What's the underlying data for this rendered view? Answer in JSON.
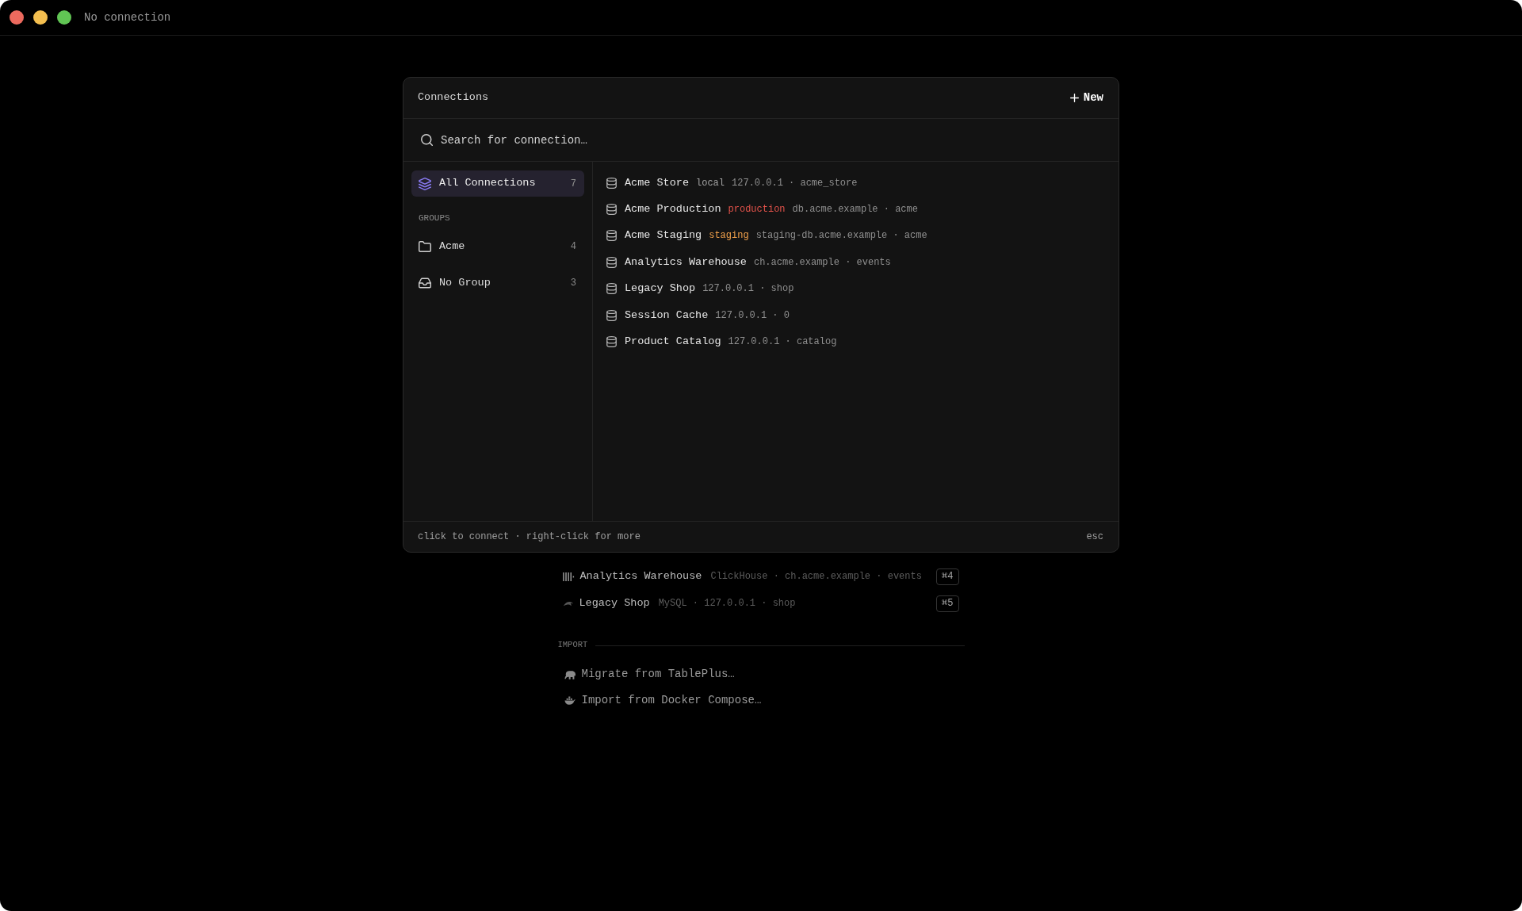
{
  "window": {
    "title": "No connection"
  },
  "dialog": {
    "title": "Connections",
    "new_button": "New",
    "search": {
      "placeholder": "Search for connection…"
    },
    "sidebar": {
      "items": [
        {
          "kind": "layers",
          "label": "All Connections",
          "count": "7",
          "selected": true
        }
      ],
      "groups_heading": "GROUPS",
      "groups": [
        {
          "kind": "folder",
          "label": "Acme",
          "count": "4",
          "selected": false
        },
        {
          "kind": "inbox",
          "label": "No Group",
          "count": "3",
          "selected": false
        }
      ]
    },
    "connections": [
      {
        "name": "Acme Store",
        "tag": {
          "text": "local",
          "color": "#a3a3a3"
        },
        "details": "127.0.0.1 · acme_store"
      },
      {
        "name": "Acme Production",
        "tag": {
          "text": "production",
          "color": "#e5534b"
        },
        "details": "db.acme.example · acme"
      },
      {
        "name": "Acme Staging",
        "tag": {
          "text": "staging",
          "color": "#f0a04b"
        },
        "details": "staging-db.acme.example · acme"
      },
      {
        "name": "Analytics Warehouse",
        "details": "ch.acme.example · events"
      },
      {
        "name": "Legacy Shop",
        "details": "127.0.0.1 · shop"
      },
      {
        "name": "Session Cache",
        "details": "127.0.0.1 · 0"
      },
      {
        "name": "Product Catalog",
        "details": "127.0.0.1 · catalog"
      }
    ],
    "footer": {
      "hint": "click to connect · right-click for more",
      "shortcut": "esc"
    }
  },
  "background": {
    "recent": [
      {
        "kind": "bars",
        "name": "Analytics Warehouse",
        "details": "ClickHouse · ch.acme.example · events",
        "shortcut": "⌘4"
      },
      {
        "kind": "dolphin",
        "name": "Legacy Shop",
        "details": "MySQL · 127.0.0.1 · shop",
        "shortcut": "⌘5"
      }
    ],
    "import_heading": "IMPORT",
    "import_items": [
      {
        "kind": "elephant",
        "label": "Migrate from TablePlus…"
      },
      {
        "kind": "whale",
        "label": "Import from Docker Compose…"
      }
    ]
  }
}
